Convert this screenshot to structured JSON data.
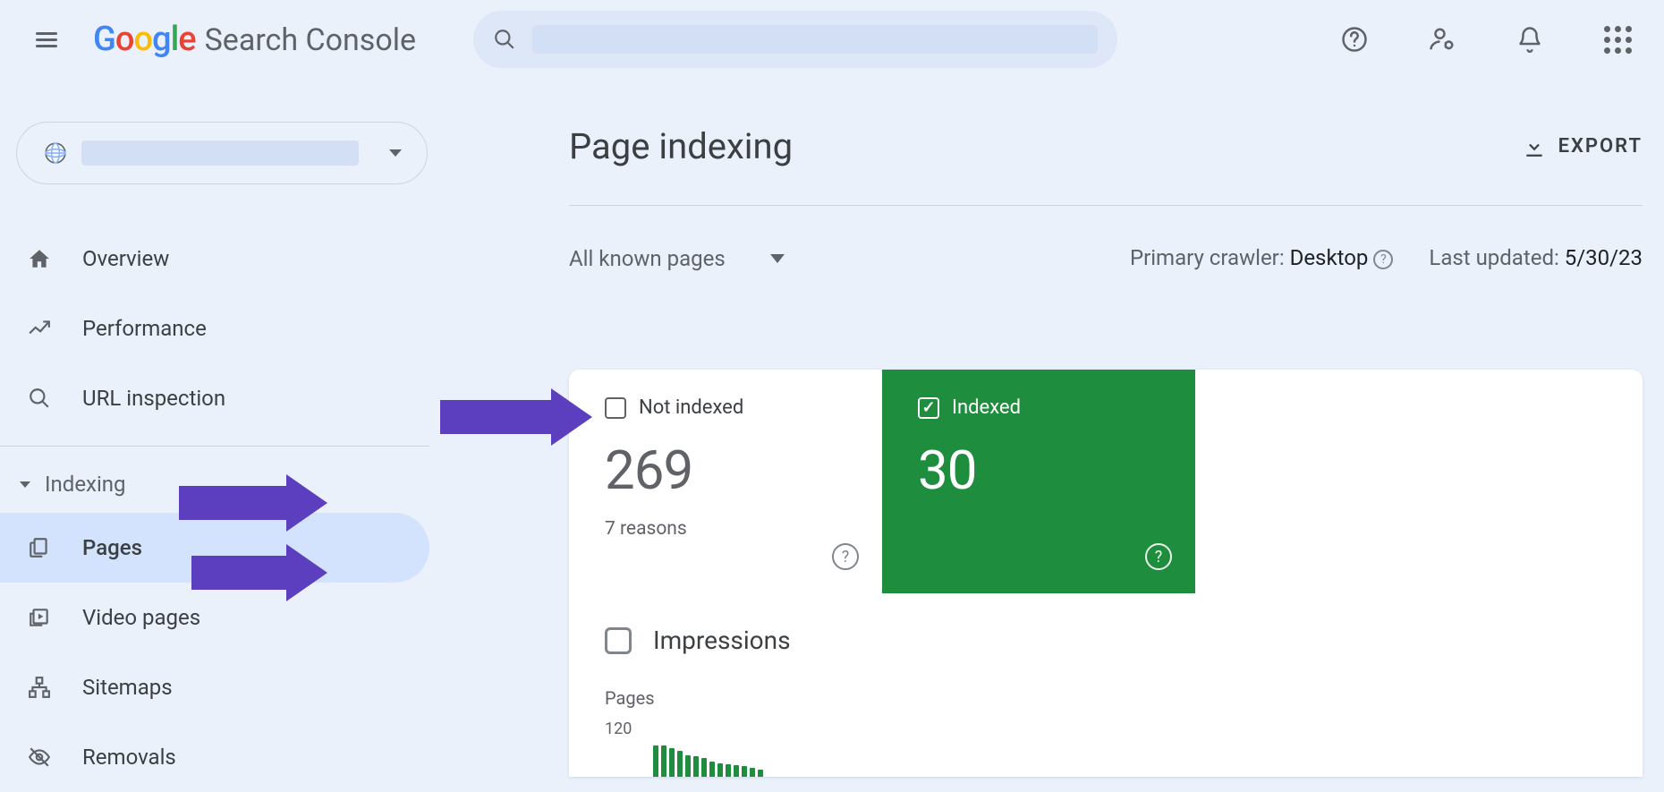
{
  "header": {
    "product_suffix": "Search Console"
  },
  "sidebar": {
    "main": [
      {
        "label": "Overview"
      },
      {
        "label": "Performance"
      },
      {
        "label": "URL inspection"
      }
    ],
    "section_title": "Indexing",
    "indexing": [
      {
        "label": "Pages",
        "active": true
      },
      {
        "label": "Video pages"
      },
      {
        "label": "Sitemaps"
      },
      {
        "label": "Removals"
      }
    ]
  },
  "page": {
    "title": "Page indexing",
    "export": "EXPORT",
    "filter_label": "All known pages",
    "crawler_label": "Primary crawler: ",
    "crawler_value": "Desktop",
    "updated_label": "Last updated: ",
    "updated_value": "5/30/23"
  },
  "tiles": {
    "not_indexed": {
      "label": "Not indexed",
      "count": "269",
      "sub": "7 reasons"
    },
    "indexed": {
      "label": "Indexed",
      "count": "30"
    }
  },
  "impressions": {
    "label": "Impressions"
  },
  "chart_data": {
    "type": "bar",
    "title": "Pages",
    "ylim": [
      0,
      120
    ],
    "ytick": "120",
    "values": [
      60,
      60,
      55,
      50,
      42,
      40,
      36,
      30,
      26,
      24,
      22,
      20,
      18,
      14
    ]
  }
}
